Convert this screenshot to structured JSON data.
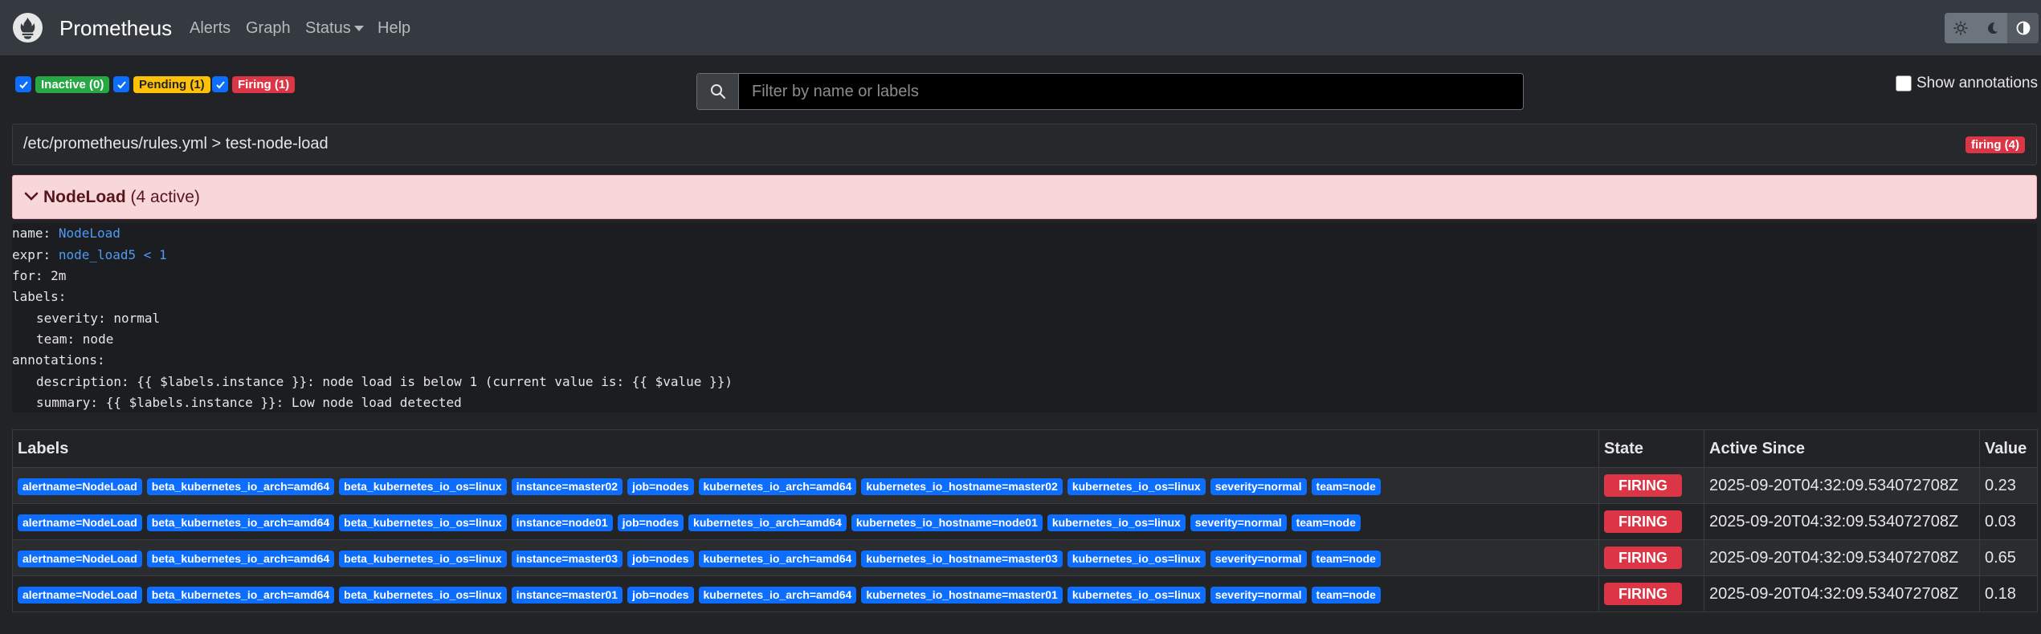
{
  "navbar": {
    "brand": "Prometheus",
    "items": [
      {
        "label": "Alerts"
      },
      {
        "label": "Graph"
      },
      {
        "label": "Status"
      },
      {
        "label": "Help"
      }
    ]
  },
  "filters": {
    "inactive": "Inactive (0)",
    "pending": "Pending (1)",
    "firing": "Firing (1)"
  },
  "search": {
    "placeholder": "Filter by name or labels"
  },
  "annotations_toggle": "Show annotations",
  "group": {
    "title": "/etc/prometheus/rules.yml > test-node-load",
    "badge": "firing (4)"
  },
  "rule": {
    "name": "NodeLoad",
    "active": "(4 active)",
    "def": {
      "name_key": "name:",
      "name_val": "NodeLoad",
      "expr_key": "expr:",
      "expr_val": "node_load5 < 1",
      "for_line": "for: 2m",
      "labels_line": "labels:",
      "severity_line": "severity: normal",
      "team_line": "team: node",
      "annotations_line": "annotations:",
      "description_line": "description: {{ $labels.instance }}: node load is below 1 (current value is: {{ $value }})",
      "summary_line": "summary: {{ $labels.instance }}: Low node load detected"
    }
  },
  "table": {
    "headers": {
      "labels": "Labels",
      "state": "State",
      "active_since": "Active Since",
      "value": "Value"
    },
    "rows": [
      {
        "labels": [
          "alertname=NodeLoad",
          "beta_kubernetes_io_arch=amd64",
          "beta_kubernetes_io_os=linux",
          "instance=master02",
          "job=nodes",
          "kubernetes_io_arch=amd64",
          "kubernetes_io_hostname=master02",
          "kubernetes_io_os=linux",
          "severity=normal",
          "team=node"
        ],
        "state": "FIRING",
        "active_since": "2025-09-20T04:32:09.534072708Z",
        "value": "0.23"
      },
      {
        "labels": [
          "alertname=NodeLoad",
          "beta_kubernetes_io_arch=amd64",
          "beta_kubernetes_io_os=linux",
          "instance=node01",
          "job=nodes",
          "kubernetes_io_arch=amd64",
          "kubernetes_io_hostname=node01",
          "kubernetes_io_os=linux",
          "severity=normal",
          "team=node"
        ],
        "state": "FIRING",
        "active_since": "2025-09-20T04:32:09.534072708Z",
        "value": "0.03"
      },
      {
        "labels": [
          "alertname=NodeLoad",
          "beta_kubernetes_io_arch=amd64",
          "beta_kubernetes_io_os=linux",
          "instance=master03",
          "job=nodes",
          "kubernetes_io_arch=amd64",
          "kubernetes_io_hostname=master03",
          "kubernetes_io_os=linux",
          "severity=normal",
          "team=node"
        ],
        "state": "FIRING",
        "active_since": "2025-09-20T04:32:09.534072708Z",
        "value": "0.65"
      },
      {
        "labels": [
          "alertname=NodeLoad",
          "beta_kubernetes_io_arch=amd64",
          "beta_kubernetes_io_os=linux",
          "instance=master01",
          "job=nodes",
          "kubernetes_io_arch=amd64",
          "kubernetes_io_hostname=master01",
          "kubernetes_io_os=linux",
          "severity=normal",
          "team=node"
        ],
        "state": "FIRING",
        "active_since": "2025-09-20T04:32:09.534072708Z",
        "value": "0.18"
      }
    ]
  },
  "colors": {
    "navbar": "#343a40",
    "firing": "#dc3545",
    "pending": "#ffc107",
    "inactive": "#28a745",
    "label_badge": "#0d6efd"
  }
}
